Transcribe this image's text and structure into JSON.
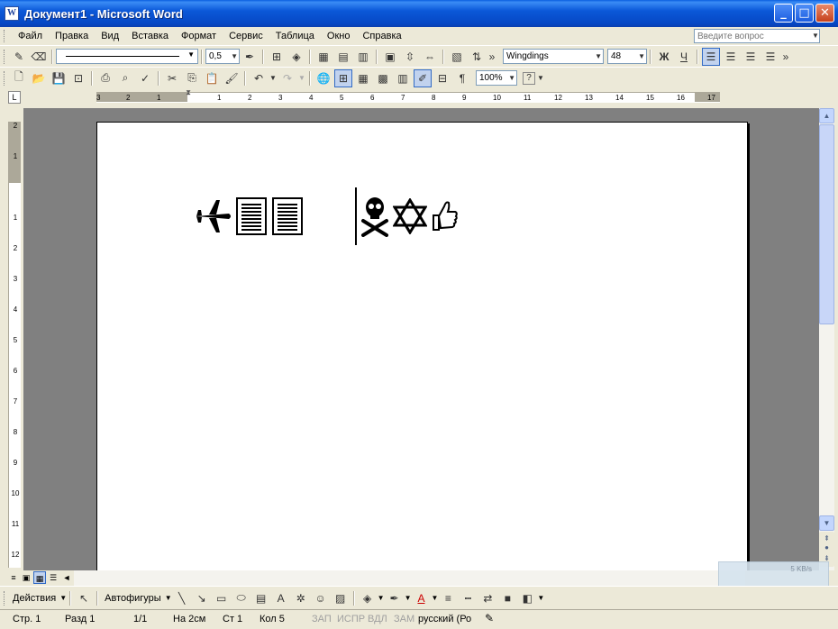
{
  "window": {
    "title": "Документ1 - Microsoft Word",
    "controls": {
      "minimize": "_",
      "maximize": "□",
      "close": "✕"
    }
  },
  "menu": {
    "items": [
      "Файл",
      "Правка",
      "Вид",
      "Вставка",
      "Формат",
      "Сервис",
      "Таблица",
      "Окно",
      "Справка"
    ],
    "help_placeholder": "Введите вопрос"
  },
  "formatting_toolbar": {
    "line_weight": "0,5",
    "font_name": "Wingdings",
    "font_size": "48",
    "bold_label": "Ж",
    "underline_label": "Ч"
  },
  "standard_toolbar": {
    "zoom": "100%",
    "paragraph_mark": "¶",
    "help": "?"
  },
  "ruler": {
    "ticks": [
      "3",
      "2",
      "1",
      "1",
      "2",
      "3",
      "4",
      "5",
      "6",
      "7",
      "8",
      "9",
      "10",
      "11",
      "12",
      "13",
      "14",
      "15",
      "16",
      "17"
    ],
    "vticks": [
      "2",
      "1",
      "1",
      "2",
      "3",
      "4",
      "5",
      "6",
      "7",
      "8",
      "9",
      "10",
      "11",
      "12"
    ]
  },
  "document": {
    "glyphs_before_cursor": [
      "✈",
      "▤",
      "▤"
    ],
    "glyphs_after_cursor": [
      "☠",
      "✡",
      "👍"
    ]
  },
  "draw_toolbar": {
    "actions_label": "Действия",
    "autoshapes_label": "Автофигуры"
  },
  "net_widget": {
    "speed": "5 KB/s"
  },
  "status": {
    "page": "Стр. 1",
    "section": "Разд 1",
    "pages": "1/1",
    "at": "На 2см",
    "line": "Ст 1",
    "col": "Кол 5",
    "rec": "ЗАП",
    "trk": "ИСПР",
    "ext": "ВДЛ",
    "ovr": "ЗАМ",
    "language": "русский (Ро"
  }
}
